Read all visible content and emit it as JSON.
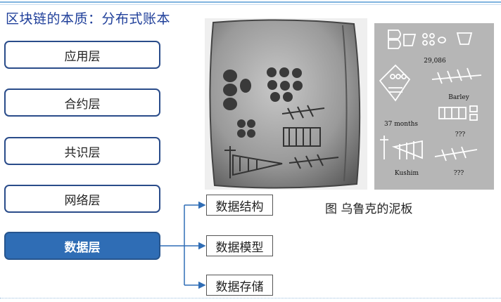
{
  "title": "区块链的本质：分布式账本",
  "layers": [
    {
      "label": "应用层"
    },
    {
      "label": "合约层"
    },
    {
      "label": "共识层"
    },
    {
      "label": "网络层"
    },
    {
      "label": "数据层"
    }
  ],
  "data_layer_items": [
    {
      "label": "数据结构"
    },
    {
      "label": "数据模型"
    },
    {
      "label": "数据存储"
    }
  ],
  "figure_caption": "图 乌鲁克的泥板",
  "drawing_labels": {
    "number": "29,086",
    "barley": "Barley",
    "months": "37 months",
    "unknown1": "???",
    "kushim": "Kushim",
    "unknown2": "???"
  },
  "colors": {
    "title": "#1f3f9a",
    "layer_border": "#2a4c8a",
    "active_fill": "#2f6db5",
    "connector": "#2f6db5"
  }
}
